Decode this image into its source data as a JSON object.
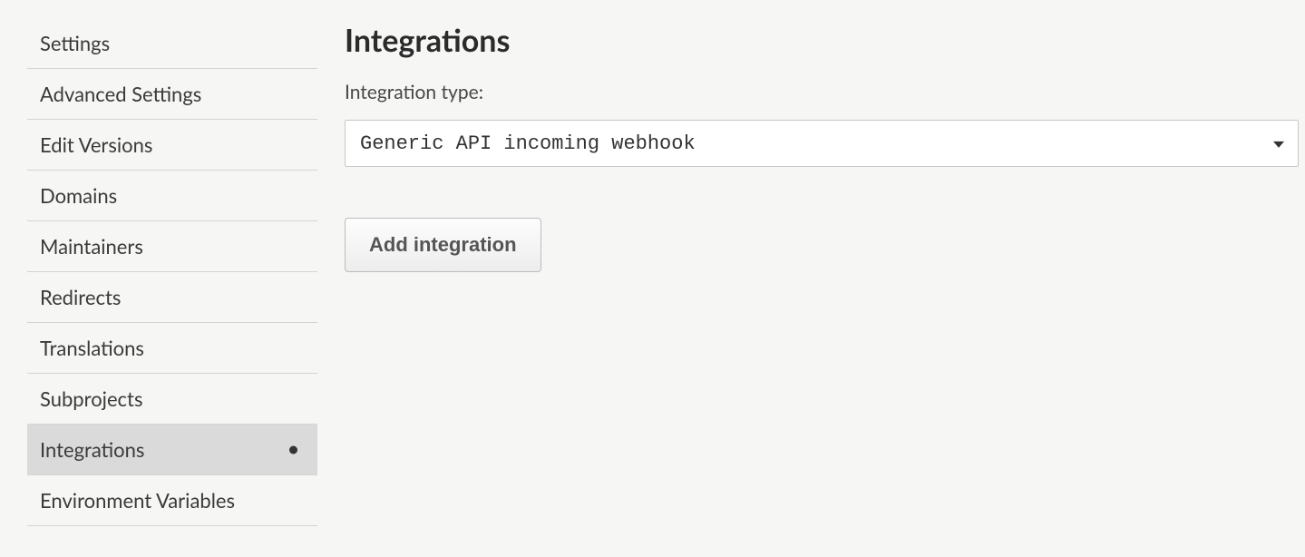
{
  "sidebar": {
    "items": [
      {
        "label": "Settings"
      },
      {
        "label": "Advanced Settings"
      },
      {
        "label": "Edit Versions"
      },
      {
        "label": "Domains"
      },
      {
        "label": "Maintainers"
      },
      {
        "label": "Redirects"
      },
      {
        "label": "Translations"
      },
      {
        "label": "Subprojects"
      },
      {
        "label": "Integrations"
      },
      {
        "label": "Environment Variables"
      }
    ],
    "active_index": 8
  },
  "main": {
    "heading": "Integrations",
    "field_label": "Integration type:",
    "selected_option": "Generic API incoming webhook",
    "add_button_label": "Add integration"
  }
}
